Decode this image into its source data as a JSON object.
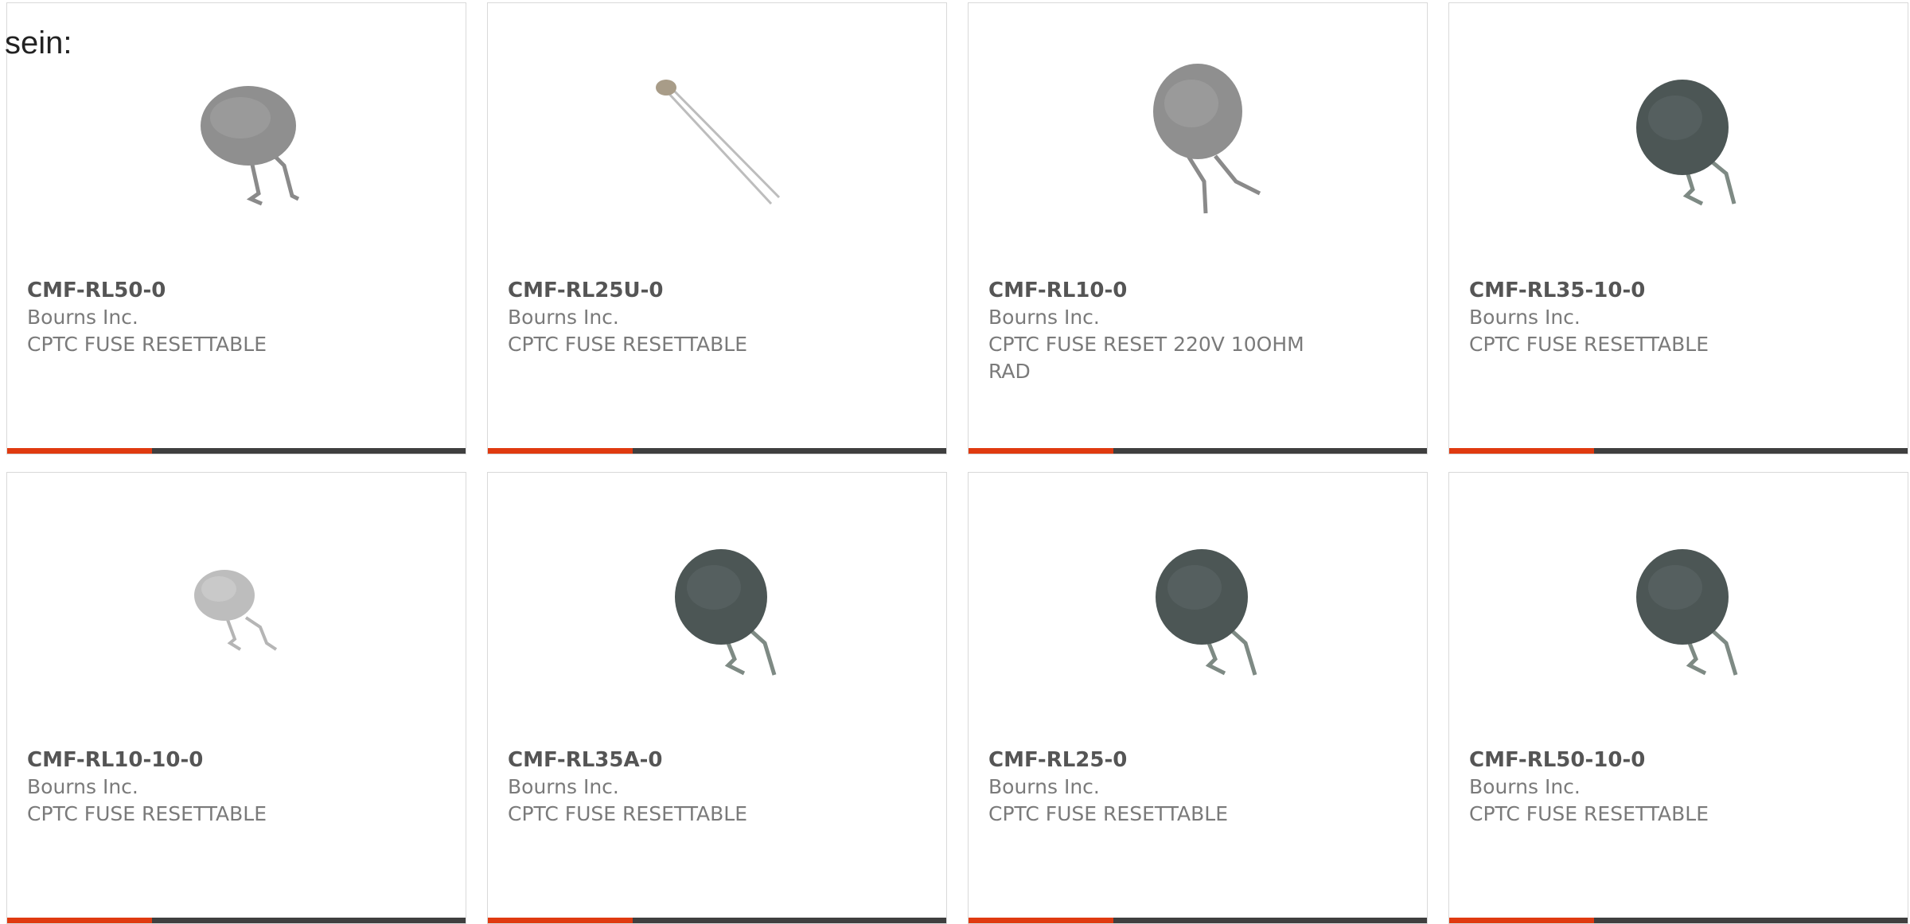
{
  "heading": "sein:",
  "colors": {
    "accent": "#e03a10",
    "bar": "#3f3f3f"
  },
  "products": [
    {
      "part_number": "CMF-RL50-0",
      "manufacturer": "Bourns Inc.",
      "description": "CPTC FUSE RESETTABLE",
      "image": "thermistor-gray-icon"
    },
    {
      "part_number": "CMF-RL25U-0",
      "manufacturer": "Bourns Inc.",
      "description": "CPTC FUSE RESETTABLE",
      "image": "thermistor-small-bead-icon"
    },
    {
      "part_number": "CMF-RL10-0",
      "manufacturer": "Bourns Inc.",
      "description": "CPTC FUSE RESET 220V 10OHM RAD",
      "image": "thermistor-gray-icon"
    },
    {
      "part_number": "CMF-RL35-10-0",
      "manufacturer": "Bourns Inc.",
      "description": "CPTC FUSE RESETTABLE",
      "image": "thermistor-dark-icon"
    },
    {
      "part_number": "CMF-RL10-10-0",
      "manufacturer": "Bourns Inc.",
      "description": "CPTC FUSE RESETTABLE",
      "image": "thermistor-light-icon"
    },
    {
      "part_number": "CMF-RL35A-0",
      "manufacturer": "Bourns Inc.",
      "description": "CPTC FUSE RESETTABLE",
      "image": "thermistor-dark-icon"
    },
    {
      "part_number": "CMF-RL25-0",
      "manufacturer": "Bourns Inc.",
      "description": "CPTC FUSE RESETTABLE",
      "image": "thermistor-dark-icon"
    },
    {
      "part_number": "CMF-RL50-10-0",
      "manufacturer": "Bourns Inc.",
      "description": "CPTC FUSE RESETTABLE",
      "image": "thermistor-dark-icon"
    }
  ]
}
